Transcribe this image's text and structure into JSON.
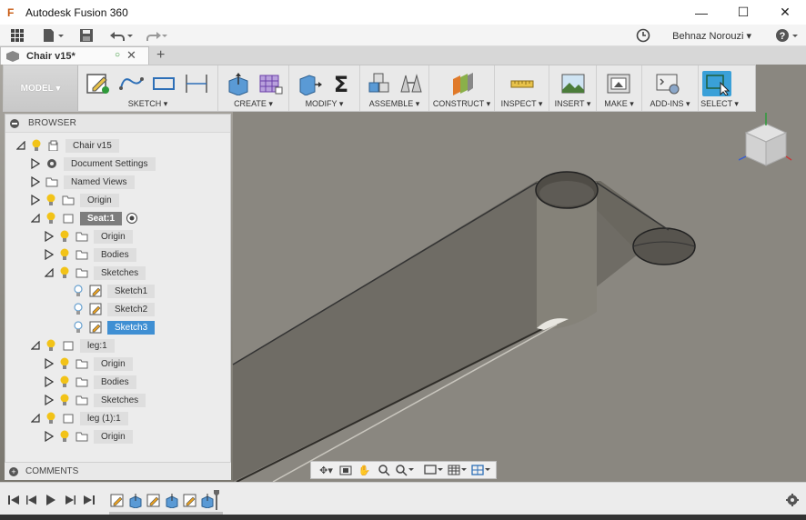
{
  "window": {
    "title": "Autodesk Fusion 360",
    "app_icon": "F",
    "minimize": "—",
    "maximize": "☐",
    "close": "✕"
  },
  "quick_access": {
    "user_name": "Behnaz Norouzi ▾",
    "help": "?"
  },
  "tabs": {
    "document_name": "Chair v15*",
    "new_tab": "+"
  },
  "toolbar": {
    "mode": "MODEL ▾",
    "groups": [
      {
        "label": "SKETCH ▾",
        "icons": [
          "sketch-create-icon",
          "spline-icon",
          "rectangle-icon",
          "dimension-icon"
        ]
      },
      {
        "label": "CREATE ▾",
        "icons": [
          "extrude-box-icon",
          "sculpt-form-icon"
        ]
      },
      {
        "label": "MODIFY ▾",
        "icons": [
          "press-pull-icon",
          "sigma-icon"
        ]
      },
      {
        "label": "ASSEMBLE ▾",
        "icons": [
          "new-component-icon",
          "joint-icon"
        ]
      },
      {
        "label": "CONSTRUCT ▾",
        "icons": [
          "offset-plane-icon"
        ]
      },
      {
        "label": "INSPECT ▾",
        "icons": [
          "measure-icon"
        ]
      },
      {
        "label": "INSERT ▾",
        "icons": [
          "insert-image-icon"
        ]
      },
      {
        "label": "MAKE ▾",
        "icons": [
          "print-3d-icon"
        ]
      },
      {
        "label": "ADD-INS ▾",
        "icons": [
          "scripts-icon"
        ]
      },
      {
        "label": "SELECT ▾",
        "icons": [
          "select-icon"
        ]
      }
    ]
  },
  "browser": {
    "title": "BROWSER",
    "nodes": [
      {
        "label": "Chair v15",
        "state": "normal"
      },
      {
        "label": "Document Settings",
        "state": "normal"
      },
      {
        "label": "Named Views",
        "state": "normal"
      },
      {
        "label": "Origin",
        "state": "normal"
      },
      {
        "label": "Seat:1",
        "state": "active"
      },
      {
        "label": "Origin",
        "state": "normal"
      },
      {
        "label": "Bodies",
        "state": "normal"
      },
      {
        "label": "Sketches",
        "state": "normal"
      },
      {
        "label": "Sketch1",
        "state": "normal"
      },
      {
        "label": "Sketch2",
        "state": "normal"
      },
      {
        "label": "Sketch3",
        "state": "selected"
      },
      {
        "label": "leg:1",
        "state": "normal"
      },
      {
        "label": "Origin",
        "state": "normal"
      },
      {
        "label": "Bodies",
        "state": "normal"
      },
      {
        "label": "Sketches",
        "state": "normal"
      },
      {
        "label": "leg (1):1",
        "state": "normal"
      },
      {
        "label": "Origin",
        "state": "normal"
      }
    ]
  },
  "comments": {
    "title": "COMMENTS"
  },
  "colors": {
    "accent": "#3f8fd3",
    "viewport_top": "#a9a6a0",
    "viewport_bottom": "#7a776f",
    "bulb": "#f2c318"
  }
}
